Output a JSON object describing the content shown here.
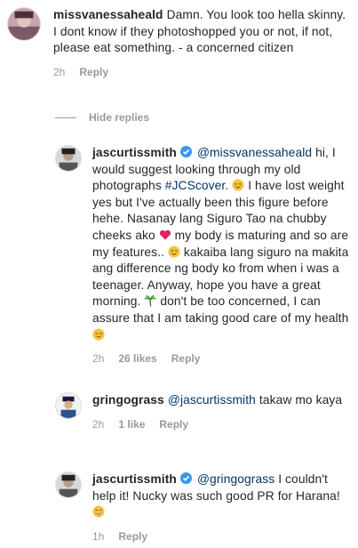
{
  "comments": [
    {
      "username": "missvanessaheald",
      "text": "Damn. You look too hella skinny. I dont know if they photoshopped you or not, if not, please eat something. - a concerned citizen",
      "time": "2h",
      "reply": "Reply"
    }
  ],
  "hide_replies": "Hide replies",
  "replies": [
    {
      "username": "jascurtissmith",
      "mention": "@missvanessaheald",
      "text_part1": "hi, I would suggest looking through my old photographs",
      "hashtag": "#JCScover.",
      "text_part2": "I have lost weight yes but I've actually been this figure before hehe. Nasanay lang Siguro Tao na chubby cheeks ako",
      "text_part3": "my body is maturing and so are my features..",
      "text_part4": "kakaiba lang siguro na makita ang difference ng body ko from when i was a teenager. Anyway, hope you have a great morning.",
      "text_part5": "don't be too concerned, I can assure that I am taking good care of my health",
      "time": "2h",
      "likes": "26 likes",
      "reply": "Reply"
    },
    {
      "username": "gringograss",
      "mention": "@jascurtissmith",
      "text": "takaw mo kaya",
      "time": "2h",
      "likes": "1 like",
      "reply": "Reply"
    },
    {
      "username": "jascurtissmith",
      "mention": "@gringograss",
      "text": "I couldn't help it! Nucky was such good PR for Harana!",
      "time": "1h",
      "reply": "Reply"
    }
  ],
  "icons": {
    "smile": "relieved-face-emoji",
    "heart": "red-heart-emoji",
    "palm": "palm-tree-emoji",
    "grin": "grinning-face-emoji"
  },
  "colors": {
    "text": "#262626",
    "muted": "#999999",
    "link": "#003569",
    "heart": "#e0245e",
    "emoji": "#f5c33b"
  }
}
